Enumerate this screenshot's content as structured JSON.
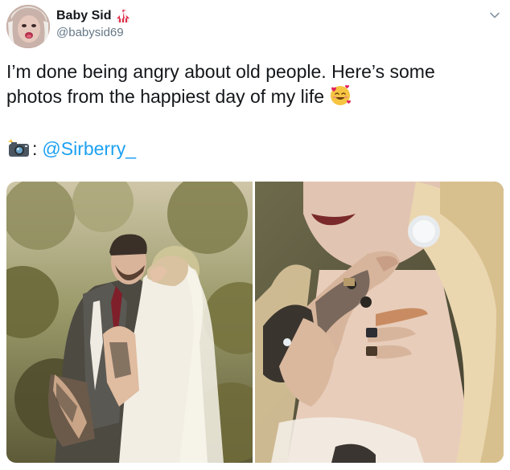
{
  "user": {
    "display_name": "Baby Sid",
    "handle": "@babysid69",
    "name_emoji": "circus-tent-emoji"
  },
  "tweet": {
    "line1": "I’m done being angry about old people. Here’s some",
    "line2": "photos from the happiest day of my life",
    "text_emoji": "smiling-face-with-hearts-emoji",
    "credit_icon": "camera-with-flash-emoji",
    "credit_sep": ":",
    "mention": "@Sirberry_"
  },
  "photos": [
    {
      "name": "wedding-couple-photo"
    },
    {
      "name": "tattooed-hand-on-neck-photo"
    }
  ],
  "colors": {
    "link": "#1da1f2",
    "text": "#14171a",
    "muted": "#657786"
  }
}
